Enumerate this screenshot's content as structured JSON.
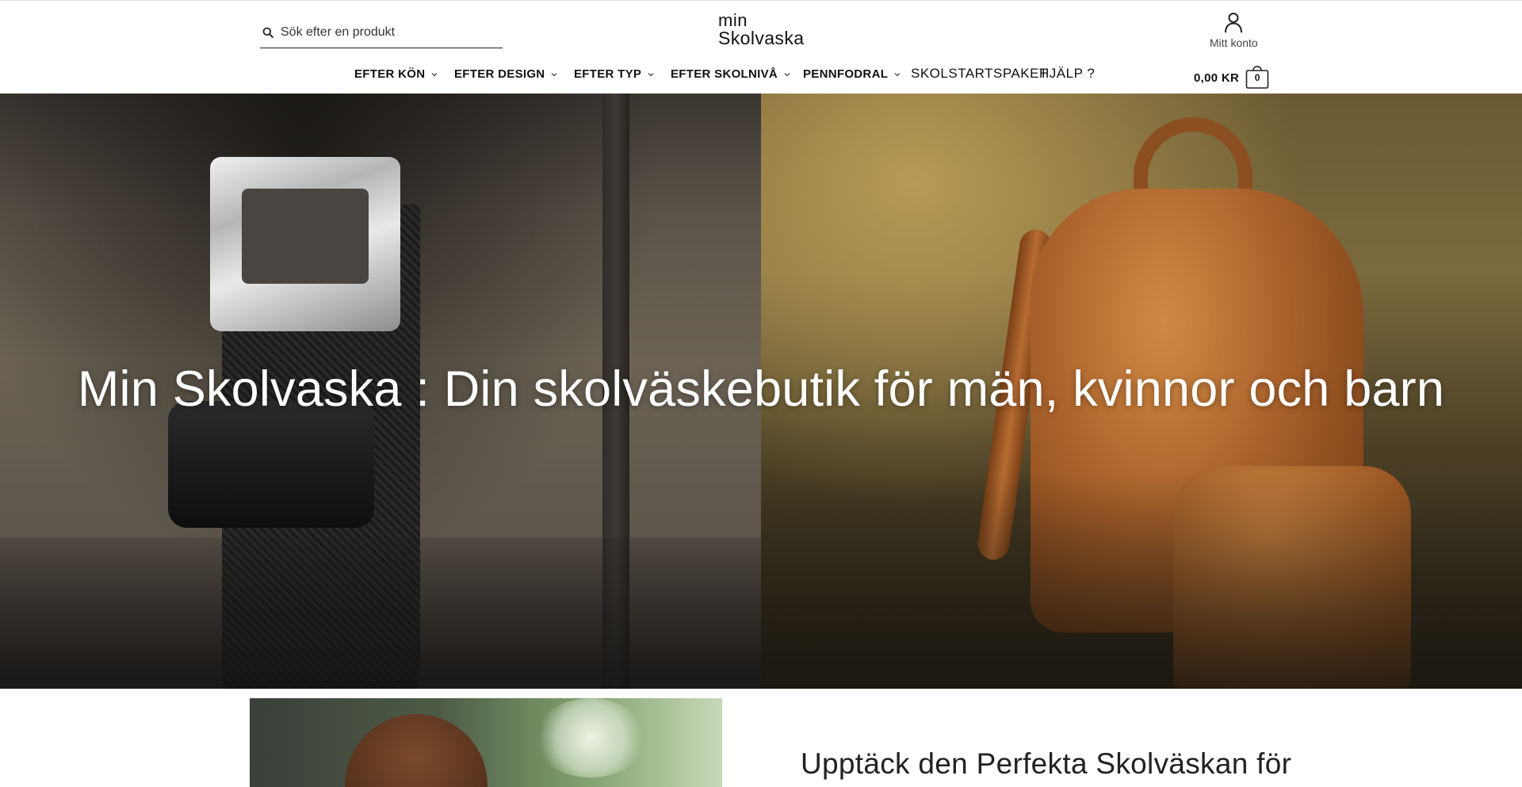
{
  "header": {
    "search": {
      "placeholder": "Sök efter en produkt",
      "value": ""
    },
    "logo": {
      "line1": "min",
      "line2": "Skolvaska"
    },
    "account": {
      "label": "Mitt konto"
    },
    "cart": {
      "total": "0,00 KR",
      "count": "0"
    }
  },
  "nav": {
    "items": [
      {
        "label": "EFTER KÖN",
        "has_dropdown": true
      },
      {
        "label": "EFTER DESIGN",
        "has_dropdown": true
      },
      {
        "label": "EFTER TYP",
        "has_dropdown": true
      },
      {
        "label": "EFTER SKOLNIVÅ",
        "has_dropdown": true
      },
      {
        "label": "PENNFODRAL",
        "has_dropdown": true
      },
      {
        "label": "SKOLSTARTSPAKET",
        "has_dropdown": false
      },
      {
        "label": "HJÄLP ?",
        "has_dropdown": false
      }
    ]
  },
  "hero": {
    "title": "Min Skolvaska : Din skolväskebutik för män, kvinnor och barn"
  },
  "promo": {
    "heading": "Upptäck den Perfekta Skolväskan för"
  },
  "icons": {
    "search": "search-icon",
    "user": "user-icon",
    "bag": "bag-icon",
    "chevron": "chevron-down-icon"
  },
  "colors": {
    "text": "#111111",
    "logo_dot": "#6b3a1c",
    "hero_text": "#ffffff"
  }
}
